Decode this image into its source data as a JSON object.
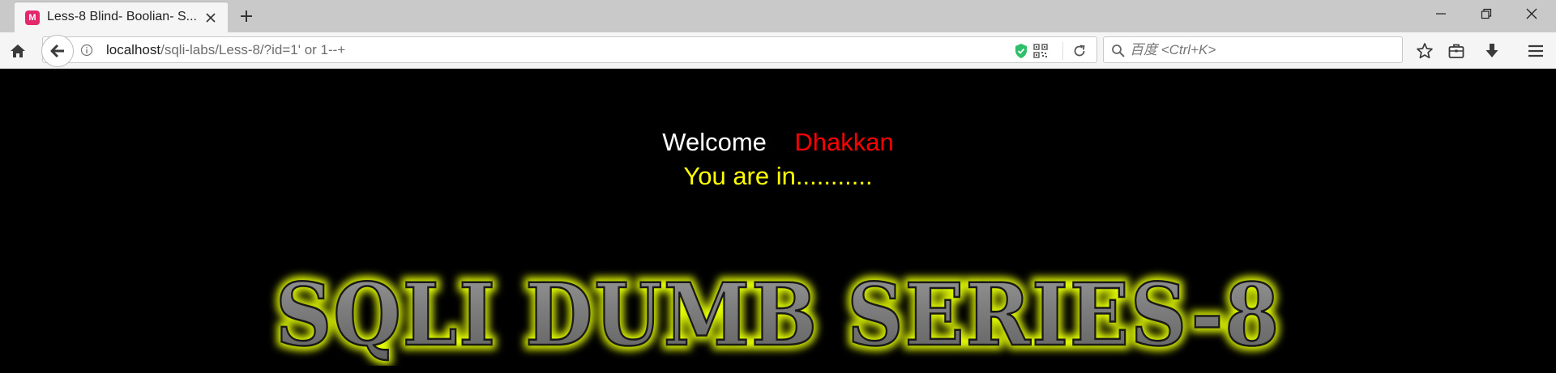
{
  "tab": {
    "favicon_letter": "M",
    "title": "Less-8 Blind- Boolian- S...",
    "favicon_color": "#e3286c"
  },
  "window_controls": {
    "minimize": "minimize-icon",
    "restore": "restore-icon",
    "close": "close-icon"
  },
  "address_bar": {
    "host": "localhost",
    "path": "/sqli-labs/Less-8/?id=1' or 1--+"
  },
  "search": {
    "placeholder": "百度 <Ctrl+K>"
  },
  "page": {
    "welcome_word": "Welcome",
    "welcome_name": "Dhakkan",
    "status": "You are in...........",
    "banner_text": "SQLI DUMB SERIES-8",
    "colors": {
      "background": "#000000",
      "welcome": "#ffffff",
      "name": "#ff0000",
      "status": "#ffff00",
      "banner_glow": "#e6ff00"
    }
  }
}
